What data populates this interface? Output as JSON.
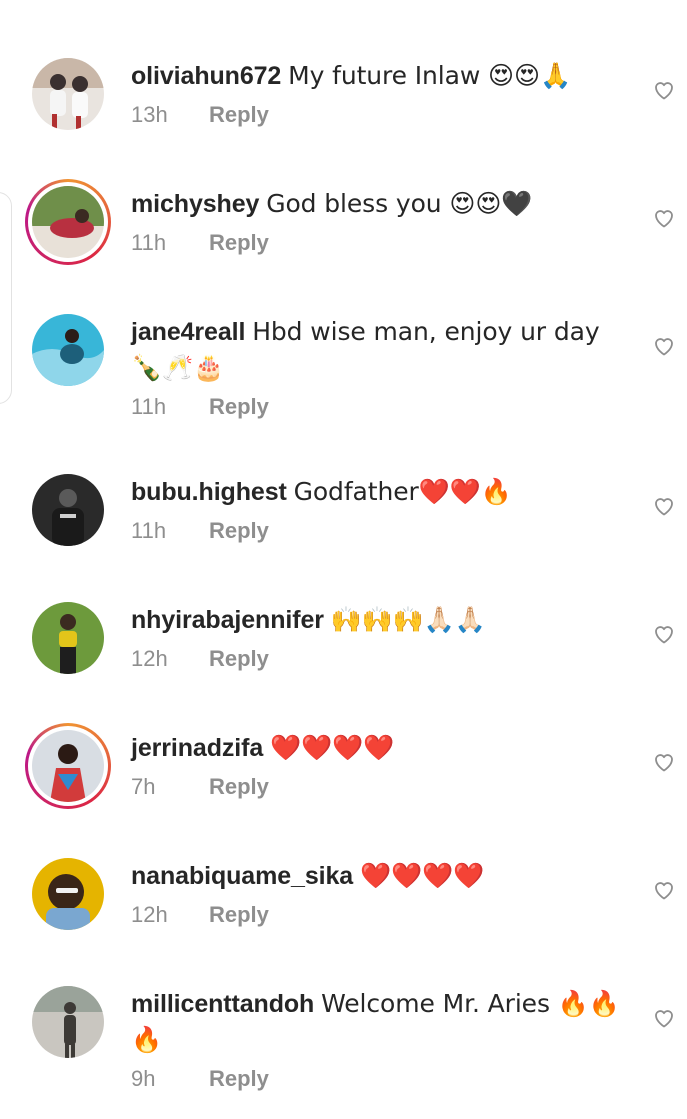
{
  "comments": [
    {
      "username": "oliviahun672",
      "text": "My future Inlaw 😍😍🙏",
      "time": "13h",
      "reply": "Reply",
      "story": false,
      "avatar_colors": [
        "#c9b7a8",
        "#3a3030",
        "#e9e4df"
      ]
    },
    {
      "username": "michyshey",
      "text": "God bless you 😍😍🖤",
      "time": "11h",
      "reply": "Reply",
      "story": true,
      "avatar_colors": [
        "#6f8f4a",
        "#b83040",
        "#e8e1d8"
      ]
    },
    {
      "username": "jane4reall",
      "text": "Hbd wise man, enjoy ur day 🍾🥂🎂",
      "time": "11h",
      "reply": "Reply",
      "story": false,
      "avatar_colors": [
        "#38b6d8",
        "#1d5f7a",
        "#8fd6ea"
      ]
    },
    {
      "username": "bubu.highest",
      "text": "Godfather❤️❤️🔥",
      "time": "11h",
      "reply": "Reply",
      "story": false,
      "avatar_colors": [
        "#2a2a2a",
        "#5a5a5a",
        "#cfcfcf"
      ]
    },
    {
      "username": "nhyirabajennifer",
      "text": "🙌🙌🙌🙏🏻🙏🏻",
      "time": "12h",
      "reply": "Reply",
      "story": false,
      "avatar_colors": [
        "#6d9a3c",
        "#e2c51a",
        "#3b2a20"
      ]
    },
    {
      "username": "jerrinadzifa",
      "text": "❤️❤️❤️❤️",
      "time": "7h",
      "reply": "Reply",
      "story": true,
      "avatar_colors": [
        "#d8dde3",
        "#d23b3b",
        "#2e8bcf"
      ]
    },
    {
      "username": "nanabiquame_sika",
      "text": "❤️❤️❤️❤️",
      "time": "12h",
      "reply": "Reply",
      "story": false,
      "avatar_colors": [
        "#e5b400",
        "#3a2618",
        "#7aa7d0"
      ]
    },
    {
      "username": "millicenttandoh",
      "text": "Welcome Mr. Aries 🔥🔥🔥",
      "time": "9h",
      "reply": "Reply",
      "story": false,
      "avatar_colors": [
        "#c9c6c0",
        "#3d3a36",
        "#9aa39a"
      ]
    }
  ]
}
